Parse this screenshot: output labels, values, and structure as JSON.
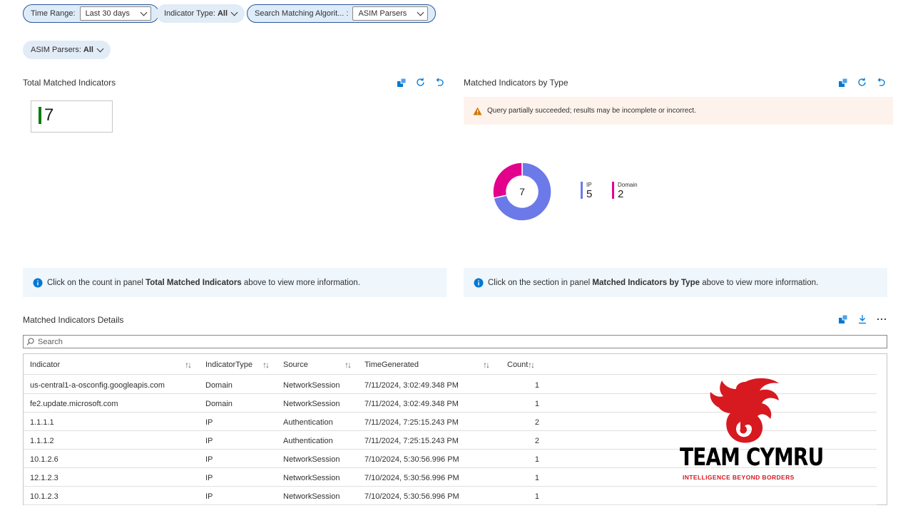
{
  "filters": {
    "time_range": {
      "label": "Time Range:",
      "value": "Last 30 days"
    },
    "indicator_type": {
      "label": "Indicator Type:",
      "value": "All"
    },
    "search_algorithm": {
      "label": "Search Matching Algorit... :",
      "value": "ASIM Parsers"
    },
    "asim_parsers": {
      "label": "ASIM Parsers:",
      "value": "All"
    }
  },
  "total_panel": {
    "title": "Total Matched Indicators",
    "value": "7",
    "info_prefix": "Click on the count in panel ",
    "info_bold": "Total Matched Indicators",
    "info_suffix": " above to view more information."
  },
  "type_panel": {
    "title": "Matched Indicators by Type",
    "warning": "Query partially succeeded; results may be incomplete or incorrect.",
    "center_total": "7",
    "info_prefix": "Click on the section in panel ",
    "info_bold": "Matched Indicators by Type",
    "info_suffix": " above to view more information."
  },
  "chart_data": {
    "type": "pie",
    "categories": [
      "IP",
      "Domain"
    ],
    "values": [
      5,
      2
    ],
    "colors": [
      "#6b7ae8",
      "#e3008c"
    ],
    "center_label": "7"
  },
  "details": {
    "title": "Matched Indicators Details",
    "search_placeholder": "Search",
    "columns": [
      "Indicator",
      "IndicatorType",
      "Source",
      "TimeGenerated",
      "Count"
    ],
    "rows": [
      {
        "indicator": "us-central1-a-osconfig.googleapis.com",
        "type": "Domain",
        "source": "NetworkSession",
        "time": "7/11/2024, 3:02:49.348 PM",
        "count": "1"
      },
      {
        "indicator": "fe2.update.microsoft.com",
        "type": "Domain",
        "source": "NetworkSession",
        "time": "7/11/2024, 3:02:49.348 PM",
        "count": "1"
      },
      {
        "indicator": "1.1.1.1",
        "type": "IP",
        "source": "Authentication",
        "time": "7/11/2024, 7:25:15.243 PM",
        "count": "2"
      },
      {
        "indicator": "1.1.1.2",
        "type": "IP",
        "source": "Authentication",
        "time": "7/11/2024, 7:25:15.243 PM",
        "count": "2"
      },
      {
        "indicator": "10.1.2.6",
        "type": "IP",
        "source": "NetworkSession",
        "time": "7/10/2024, 5:30:56.996 PM",
        "count": "1"
      },
      {
        "indicator": "12.1.2.3",
        "type": "IP",
        "source": "NetworkSession",
        "time": "7/10/2024, 5:30:56.996 PM",
        "count": "1"
      },
      {
        "indicator": "10.1.2.3",
        "type": "IP",
        "source": "NetworkSession",
        "time": "7/10/2024, 5:30:56.996 PM",
        "count": "1"
      }
    ]
  },
  "logo": {
    "name": "TEAM CYMRU",
    "tagline": "INTELLIGENCE BEYOND BORDERS",
    "color": "#d71920"
  },
  "icons": {
    "toolbar": [
      "pin-to-dashboard-icon",
      "refresh-icon",
      "undo-icon"
    ],
    "details_toolbar": [
      "pin-to-dashboard-icon",
      "download-icon",
      "more-icon"
    ],
    "warning": "warning-icon",
    "info": "info-icon",
    "search": "search-icon"
  }
}
